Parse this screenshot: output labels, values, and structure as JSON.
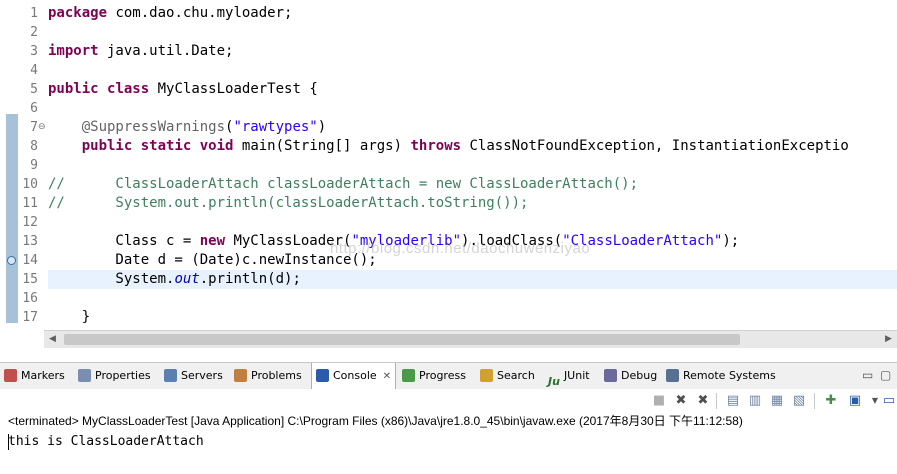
{
  "editor": {
    "line_numbers": [
      "1",
      "2",
      "3",
      "4",
      "5",
      "6",
      "7",
      "8",
      "9",
      "10",
      "11",
      "12",
      "13",
      "14",
      "15",
      "16",
      "17"
    ],
    "lines": [
      [
        {
          "t": "kw",
          "v": "package"
        },
        {
          "t": "",
          "v": " com.dao.chu.myloader;"
        }
      ],
      [],
      [
        {
          "t": "kw",
          "v": "import"
        },
        {
          "t": "",
          "v": " java.util.Date;"
        }
      ],
      [],
      [
        {
          "t": "kw",
          "v": "public"
        },
        {
          "t": "",
          "v": " "
        },
        {
          "t": "kw",
          "v": "class"
        },
        {
          "t": "",
          "v": " MyClassLoaderTest {"
        }
      ],
      [],
      [
        {
          "t": "",
          "v": "    "
        },
        {
          "t": "ann",
          "v": "@SuppressWarnings"
        },
        {
          "t": "",
          "v": "("
        },
        {
          "t": "str",
          "v": "\"rawtypes\""
        },
        {
          "t": "",
          "v": ")"
        }
      ],
      [
        {
          "t": "",
          "v": "    "
        },
        {
          "t": "kw",
          "v": "public"
        },
        {
          "t": "",
          "v": " "
        },
        {
          "t": "kw",
          "v": "static"
        },
        {
          "t": "",
          "v": " "
        },
        {
          "t": "kw",
          "v": "void"
        },
        {
          "t": "",
          "v": " main(String[] args) "
        },
        {
          "t": "kw",
          "v": "throws"
        },
        {
          "t": "",
          "v": " ClassNotFoundException, InstantiationExceptio"
        }
      ],
      [],
      [
        {
          "t": "com",
          "v": "//      ClassLoaderAttach classLoaderAttach = new ClassLoaderAttach();"
        }
      ],
      [
        {
          "t": "com",
          "v": "//      System.out.println(classLoaderAttach.toString());"
        }
      ],
      [],
      [
        {
          "t": "",
          "v": "        Class c = "
        },
        {
          "t": "kw",
          "v": "new"
        },
        {
          "t": "",
          "v": " MyClassLoader("
        },
        {
          "t": "str",
          "v": "\"myloaderlib\""
        },
        {
          "t": "",
          "v": ").loadClass("
        },
        {
          "t": "str",
          "v": "\"ClassLoaderAttach\""
        },
        {
          "t": "",
          "v": ");"
        }
      ],
      [
        {
          "t": "",
          "v": "        Date d = (Date)c.newInstance();"
        }
      ],
      [
        {
          "t": "",
          "v": "        System."
        },
        {
          "t": "stat",
          "v": "out"
        },
        {
          "t": "",
          "v": ".println(d);"
        }
      ],
      [],
      [
        {
          "t": "",
          "v": "    }"
        }
      ]
    ],
    "current_line_index": 14,
    "fold_markers": {
      "6": "⊖"
    },
    "breakpoint_marker_line": 13,
    "watermark": "http://blog.csdn.net/daochuwenziyao"
  },
  "views": {
    "tabs": [
      {
        "label": "Markers",
        "icon": "markers-icon",
        "color": "#c0504d"
      },
      {
        "label": "Properties",
        "icon": "properties-icon",
        "color": "#7a8fb0"
      },
      {
        "label": "Servers",
        "icon": "servers-icon",
        "color": "#5a7fb0"
      },
      {
        "label": "Problems",
        "icon": "problems-icon",
        "color": "#c08040"
      },
      {
        "label": "Console",
        "icon": "console-icon",
        "color": "#2a5caa",
        "active": true,
        "close": "✕"
      },
      {
        "label": "Progress",
        "icon": "progress-icon",
        "color": "#4a9a4a"
      },
      {
        "label": "Search",
        "icon": "search-icon",
        "color": "#d0a030"
      },
      {
        "label": "JUnit",
        "icon": "junit-icon",
        "color": "#2a6e2a",
        "prefix": "Ju"
      },
      {
        "label": "Debug",
        "icon": "debug-icon",
        "color": "#6a6a9a"
      },
      {
        "label": "Remote Systems",
        "icon": "remote-systems-icon",
        "color": "#5a7090"
      }
    ]
  },
  "console": {
    "status": "<terminated> MyClassLoaderTest [Java Application] C:\\Program Files (x86)\\Java\\jre1.8.0_45\\bin\\javaw.exe (2017年8月30日 下午11:12:58)",
    "output": "this is ClassLoaderAttach"
  }
}
